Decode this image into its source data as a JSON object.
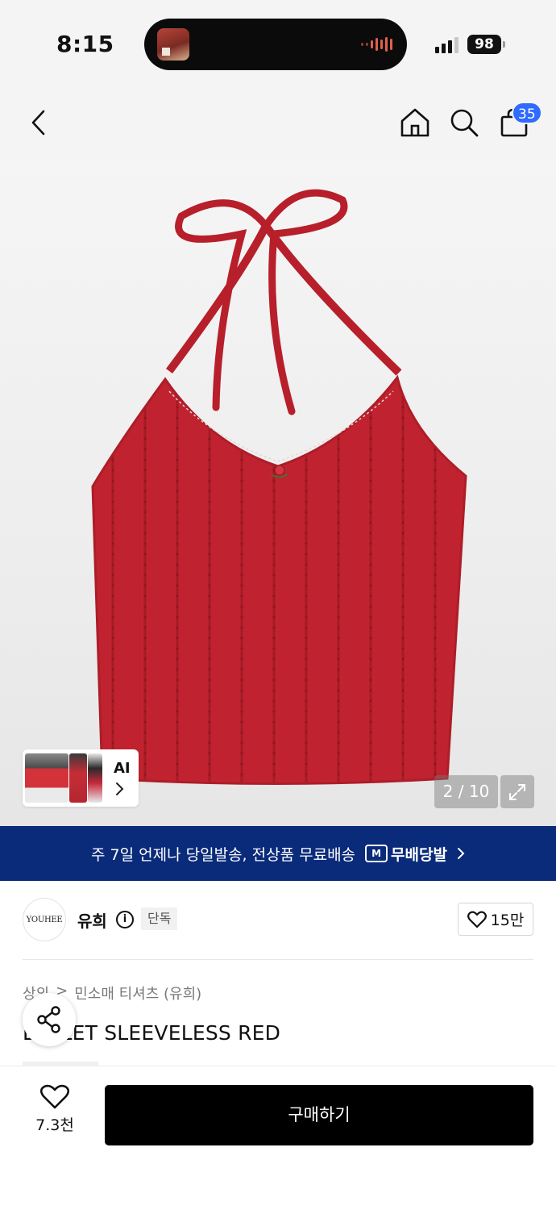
{
  "status_bar": {
    "time": "8:15",
    "battery": "98"
  },
  "header": {
    "cart_count": "35"
  },
  "gallery": {
    "ai_label": "AI",
    "page_counter": "2 / 10",
    "current_index": 2,
    "total": 10
  },
  "banner": {
    "text": "주 7일 언제나 당일발송, 전상품 무료배송",
    "logo_mark": "M",
    "logo_text": "무배당발"
  },
  "brand": {
    "logo_text": "YOUHEE",
    "name": "유희",
    "info_icon": "i",
    "badge": "단독",
    "like_count": "15만"
  },
  "product": {
    "breadcrumb": [
      "상의",
      "민소매 티셔츠 (유희)"
    ],
    "breadcrumb_sep": ">",
    "title": "EYELET SLEEVELESS RED"
  },
  "bottom_bar": {
    "like_count": "7.3천",
    "buy_label": "구매하기"
  },
  "colors": {
    "banner": "#0a2a7a",
    "badge": "#2f6bff",
    "product": "#c0232f",
    "buy_button": "#000000"
  },
  "icons": [
    "back-icon",
    "home-icon",
    "search-icon",
    "bag-icon",
    "chevron-right-icon",
    "expand-icon",
    "info-icon",
    "heart-icon",
    "share-icon"
  ]
}
